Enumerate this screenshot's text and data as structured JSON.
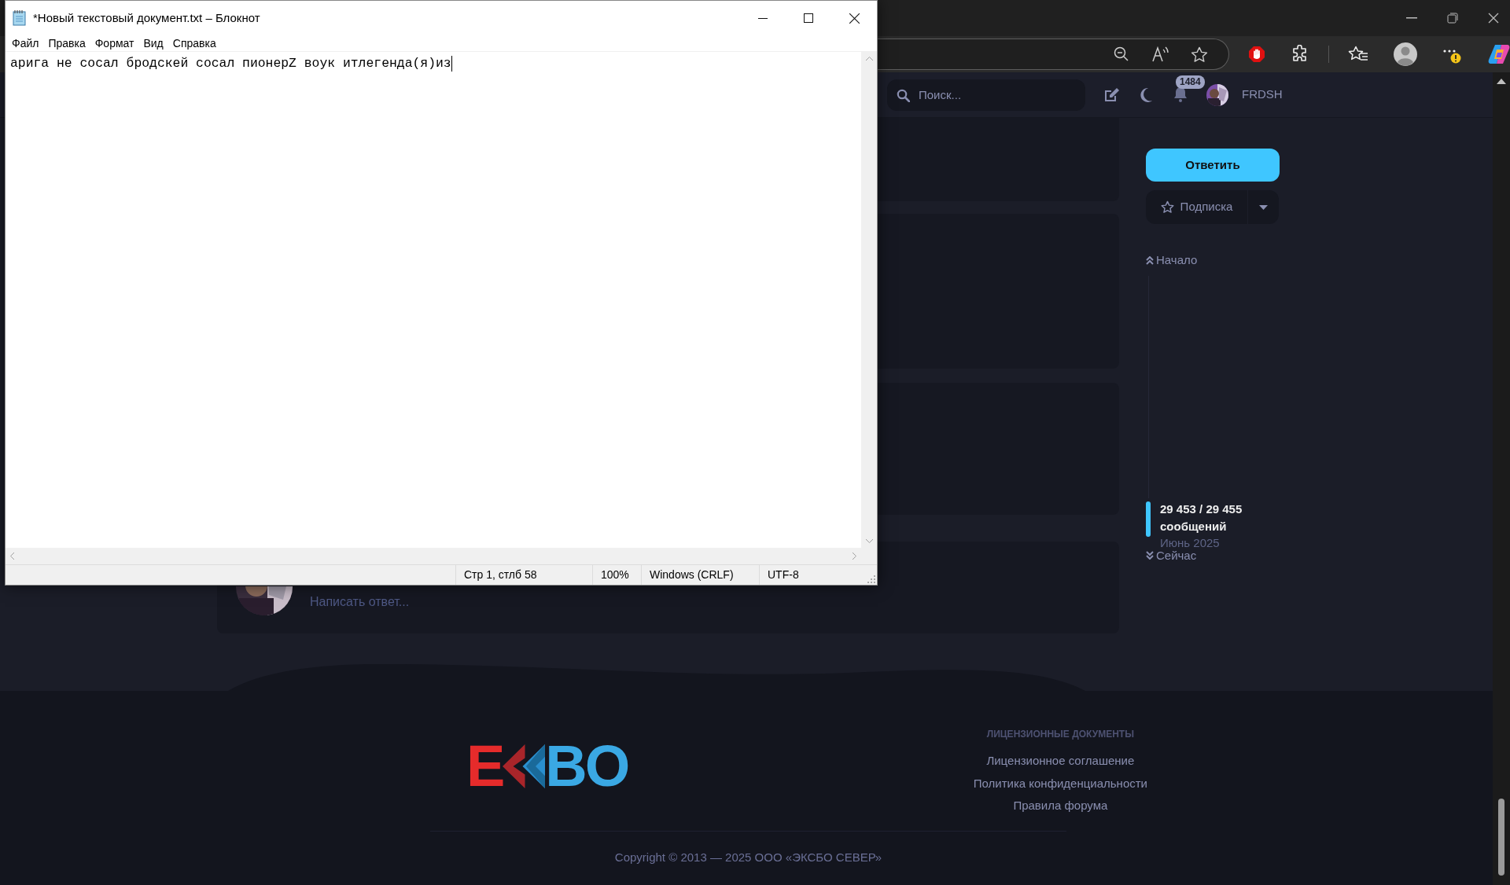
{
  "notepad": {
    "title": "*Новый текстовый документ.txt – Блокнот",
    "menu": [
      "Файл",
      "Правка",
      "Формат",
      "Вид",
      "Справка"
    ],
    "text": "арига не сосал бродскей сосал пионерZ воук итлегенда(я)из",
    "status": [
      "Стр 1, стлб 58",
      "100%",
      "Windows (CRLF)",
      "UTF-8"
    ]
  },
  "forum": {
    "search": {
      "placeholder": "Поиск..."
    },
    "notification_count": "1484",
    "username": "FRDSH",
    "reply_editor": {
      "placeholder": "Написать ответ..."
    },
    "sidebar": {
      "reply_button": "Ответить",
      "subscribe_button": "Подписка",
      "start_link": "Начало",
      "position": "29 453 / 29 455",
      "position_unit": "сообщений",
      "date": "Июнь 2025",
      "now_link": "Сейчас"
    },
    "footer": {
      "logo": {
        "left": "E",
        "right": "BO"
      },
      "heading": "ЛИЦЕНЗИОННЫЕ ДОКУМЕНТЫ",
      "links": [
        "Лицензионное соглашение",
        "Политика конфиденциальности",
        "Правила форума"
      ],
      "copyright": "Copyright © 2013 — 2025 ООО «ЭКСБО СЕВЕР»"
    }
  }
}
